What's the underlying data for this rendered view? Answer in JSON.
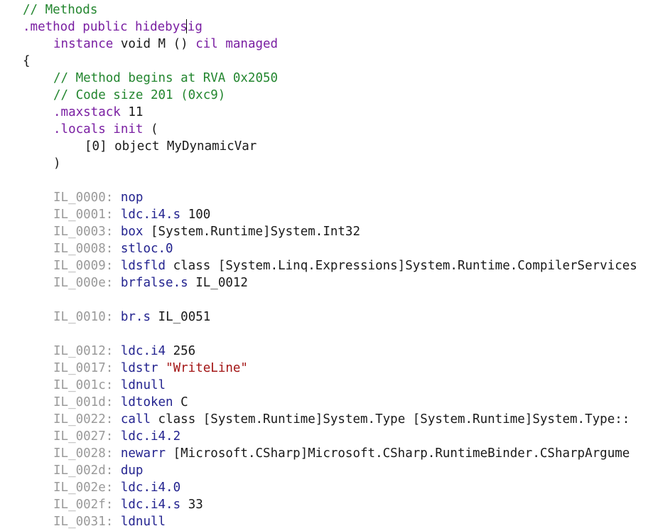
{
  "header": {
    "comment": "// Methods",
    "directive": ".method public hidebysig",
    "signature_kw1": "instance",
    "signature_mid": " void M () ",
    "signature_kw2": "cil managed",
    "open_brace": "{"
  },
  "body": {
    "comment_rva": "// Method begins at RVA 0x2050",
    "comment_size": "// Code size 201 (0xc9)",
    "maxstack_kw": ".maxstack",
    "maxstack_val": " 11",
    "locals_kw": ".locals init",
    "locals_paren": " (",
    "locals_entry": "[0] object MyDynamicVar",
    "locals_close": ")"
  },
  "instructions": [
    {
      "label": "IL_0000:",
      "op": "nop",
      "arg": ""
    },
    {
      "label": "IL_0001:",
      "op": "ldc.i4.s",
      "arg": "100"
    },
    {
      "label": "IL_0003:",
      "op": "box",
      "arg": "[System.Runtime]System.Int32"
    },
    {
      "label": "IL_0008:",
      "op": "stloc.0",
      "arg": ""
    },
    {
      "label": "IL_0009:",
      "op": "ldsfld",
      "arg": "class [System.Linq.Expressions]System.Runtime.CompilerServices"
    },
    {
      "label": "IL_000e:",
      "op": "brfalse.s",
      "arg": "IL_0012"
    },
    {
      "label": "IL_0010:",
      "op": "br.s",
      "arg": "IL_0051"
    },
    {
      "label": "IL_0012:",
      "op": "ldc.i4",
      "arg": "256"
    },
    {
      "label": "IL_0017:",
      "op": "ldstr",
      "arg": "\"WriteLine\""
    },
    {
      "label": "IL_001c:",
      "op": "ldnull",
      "arg": ""
    },
    {
      "label": "IL_001d:",
      "op": "ldtoken",
      "arg": "C"
    },
    {
      "label": "IL_0022:",
      "op": "call",
      "arg": "class [System.Runtime]System.Type [System.Runtime]System.Type::"
    },
    {
      "label": "IL_0027:",
      "op": "ldc.i4.2",
      "arg": ""
    },
    {
      "label": "IL_0028:",
      "op": "newarr",
      "arg": "[Microsoft.CSharp]Microsoft.CSharp.RuntimeBinder.CSharpArgume"
    },
    {
      "label": "IL_002d:",
      "op": "dup",
      "arg": ""
    },
    {
      "label": "IL_002e:",
      "op": "ldc.i4.0",
      "arg": ""
    },
    {
      "label": "IL_002f:",
      "op": "ldc.i4.s",
      "arg": "33"
    },
    {
      "label": "IL_0031:",
      "op": "ldnull",
      "arg": ""
    }
  ],
  "colors": {
    "comment": "#23862f",
    "keyword": "#7a1fa2",
    "label": "#9a9a9a",
    "opcode": "#23238f",
    "string": "#a31515",
    "text": "#1a1a1a"
  }
}
